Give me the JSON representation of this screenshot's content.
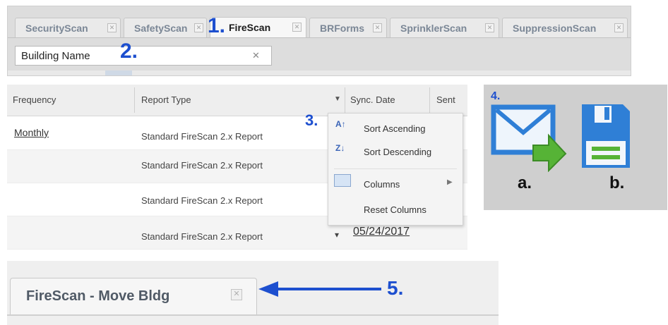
{
  "tabs": [
    {
      "label": "SecurityScan",
      "active": false
    },
    {
      "label": "SafetyScan",
      "active": false
    },
    {
      "label": "FireScan",
      "active": true
    },
    {
      "label": "BRForms",
      "active": false
    },
    {
      "label": "SprinklerScan",
      "active": false
    },
    {
      "label": "SuppressionScan",
      "active": false
    }
  ],
  "search": {
    "value": "Building Name"
  },
  "markers": {
    "m1": "1.",
    "m2": "2.",
    "m3": "3.",
    "m4": "4.",
    "m5": "5.",
    "a": "a.",
    "b": "b."
  },
  "grid": {
    "columns": [
      "Frequency",
      "Report Type",
      "Sync. Date",
      "Sent"
    ],
    "rows": [
      {
        "frequency": "Monthly",
        "report_type": "Standard FireScan 2.x Report",
        "sync_date": ""
      },
      {
        "frequency": "",
        "report_type": "Standard FireScan 2.x Report",
        "sync_date": ""
      },
      {
        "frequency": "",
        "report_type": "Standard FireScan 2.x Report",
        "sync_date": ""
      },
      {
        "frequency": "",
        "report_type": "Standard FireScan 2.x Report",
        "sync_date": "05/24/2017"
      }
    ]
  },
  "context_menu": {
    "items": [
      {
        "label": "Sort Ascending",
        "icon": "sort-ascending-icon"
      },
      {
        "label": "Sort Descending",
        "icon": "sort-descending-icon"
      },
      {
        "label": "Columns",
        "icon": "columns-icon"
      },
      {
        "label": "Reset Columns",
        "icon": ""
      }
    ]
  },
  "icons": {
    "email": "email-send-icon",
    "save": "floppy-save-icon"
  },
  "move_tab": {
    "label": "FireScan - Move Bldg"
  },
  "colors": {
    "marker_blue": "#1d4fcf",
    "icon_blue": "#2f7fd6",
    "arrow_green": "#56b336"
  }
}
